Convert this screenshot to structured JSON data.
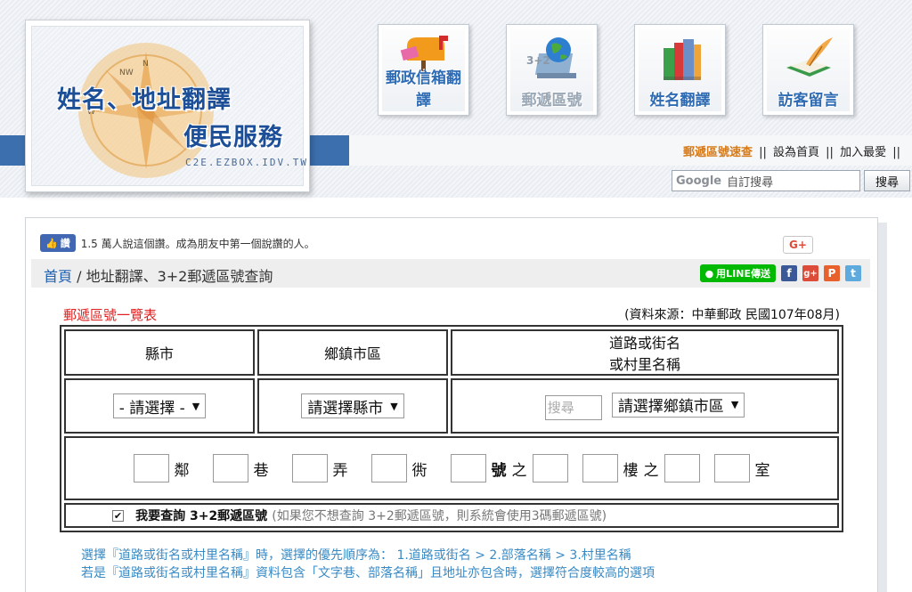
{
  "logo": {
    "line1": "姓名、地址翻譯",
    "line2": "便民服務",
    "url": "C2E.EZBOX.IDV.TW",
    "compass_letters": [
      "N",
      "NW",
      "W"
    ]
  },
  "nav": [
    {
      "label": "郵政信箱翻譯",
      "icon": "mailbox-icon"
    },
    {
      "label": "郵遞區號",
      "badge": "3+2",
      "icon": "globe-laptop-icon"
    },
    {
      "label": "姓名翻譯",
      "icon": "books-icon"
    },
    {
      "label": "訪客留言",
      "icon": "quill-book-icon"
    }
  ],
  "top_links": {
    "zip_lookup": "郵遞區號速查",
    "set_home": "設為首頁",
    "add_fav": "加入最愛",
    "sep": "||"
  },
  "search": {
    "google": "Google",
    "placeholder": "自訂搜尋",
    "button": "搜尋"
  },
  "social": {
    "like_label": "讚",
    "like_text": "1.5 萬人說這個讚。成為朋友中第一個說讚的人。",
    "gplus": "G+",
    "line": "用LINE傳送",
    "fb": "f",
    "gp": "g+",
    "p": "P",
    "tw": "t"
  },
  "breadcrumb": {
    "home": "首頁",
    "sep": " / ",
    "current": "地址翻譯、3+2郵遞區號查詢"
  },
  "list_title": "郵遞區號一覽表",
  "source": "(資料來源：中華郵政 民國107年08月)",
  "table": {
    "col_county": "縣市",
    "col_town": "鄉鎮市區",
    "col_road_1": "道路或街名",
    "col_road_2": "或村里名稱",
    "select_county": "- 請選擇 -",
    "select_town": "請選擇縣市",
    "road_search_placeholder": "搜尋",
    "select_road": "請選擇鄉鎮市區"
  },
  "address": {
    "lin": "鄰",
    "lane": "巷",
    "alley": "弄",
    "sub_alley": "衖",
    "number": "號",
    "of1": "之",
    "floor": "樓",
    "of2": "之",
    "room": "室"
  },
  "checkbox": {
    "checked": true,
    "mark": "✔",
    "label": "我要查詢 3+2郵遞區號",
    "note": "(如果您不想查詢 3+2郵遞區號，則系統會使用3碼郵遞區號)"
  },
  "notes": {
    "line1": "選擇『道路或街名或村里名稱』時，選擇的優先順序為： 1.道路或街名 > 2.部落名稱 > 3.村里名稱",
    "line2": "若是『道路或街名或村里名稱』資料包含「文字巷、部落名稱」且地址亦包含時，選擇符合度較高的選項"
  },
  "colors": {
    "brand_blue": "#3b6fae",
    "link_orange": "#d77a18",
    "title_red": "#e02020",
    "note_blue": "#3a8ac4"
  }
}
